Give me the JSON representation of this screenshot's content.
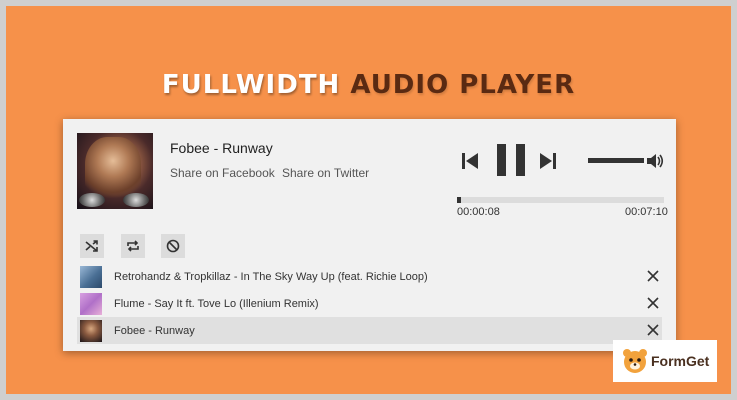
{
  "banner": {
    "title_light": "FULLWIDTH",
    "title_dark": "AUDIO PLAYER"
  },
  "player": {
    "now_playing": "Fobee - Runway",
    "share_facebook": "Share on Facebook",
    "share_twitter": "Share on Twitter",
    "current_time": "00:00:08",
    "duration": "00:07:10",
    "progress_fraction": 0.019,
    "playing": true,
    "controls": [
      "previous-icon",
      "pause-icon",
      "next-icon",
      "volume-icon"
    ],
    "tools": [
      "shuffle-icon",
      "repeat-icon",
      "block-icon"
    ],
    "playlist": [
      {
        "label": "Retrohandz & Tropkillaz - In The Sky Way Up (feat. Richie Loop)",
        "active": false
      },
      {
        "label": "Flume - Say It ft. Tove Lo (Illenium Remix)",
        "active": false
      },
      {
        "label": "Fobee - Runway",
        "active": true
      }
    ]
  },
  "brand": {
    "name": "FormGet"
  },
  "colors": {
    "background": "#f6914a",
    "title_dark": "#5a2a12",
    "player_bg": "#f1f1f1",
    "controls": "#333333",
    "active_row": "#e0e0e0"
  }
}
